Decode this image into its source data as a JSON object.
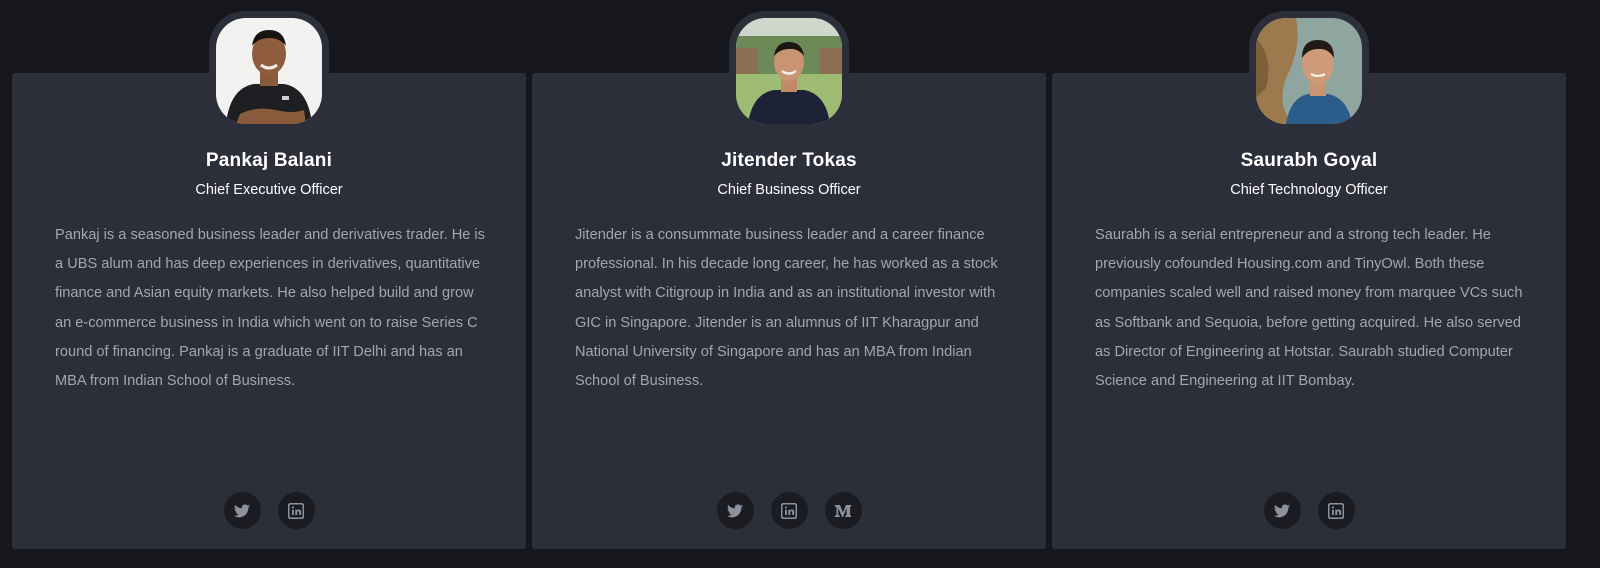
{
  "team": [
    {
      "name": "Pankaj Balani",
      "role": "Chief Executive Officer",
      "bio": "Pankaj is a seasoned business leader and derivatives trader. He is a UBS alum and has deep experiences in derivatives, quantitative finance and Asian equity markets. He also helped build and grow an e-commerce business in India which went on to raise Series C round of financing. Pankaj is a graduate of IIT Delhi and has an MBA from Indian School of Business.",
      "socials": [
        "twitter-icon",
        "linkedin-icon"
      ]
    },
    {
      "name": "Jitender Tokas",
      "role": "Chief Business Officer",
      "bio": "Jitender is a consummate business leader and a career finance professional. In his decade long career, he has worked as a stock analyst with Citigroup in India and as an institutional investor with GIC in Singapore. Jitender is an alumnus of IIT Kharagpur and National University of Singapore and has an MBA from Indian School of Business.",
      "socials": [
        "twitter-icon",
        "linkedin-icon",
        "medium-icon"
      ]
    },
    {
      "name": "Saurabh Goyal",
      "role": "Chief Technology Officer",
      "bio": "Saurabh is a serial entrepreneur and a strong tech leader. He previously cofounded Housing.com and TinyOwl. Both these companies scaled well and raised money from marquee VCs such as Softbank and Sequoia, before getting acquired. He also served as Director of Engineering at Hotstar. Saurabh studied Computer Science and Engineering at IIT Bombay.",
      "socials": [
        "twitter-icon",
        "linkedin-icon"
      ]
    }
  ],
  "colors": {
    "page_bg": "#16171c",
    "card_bg": "#2c2e3a",
    "body_text": "#a3a6b2",
    "heading_text": "#ffffff",
    "social_bg": "#1b1c22",
    "social_icon": "#8e919d"
  }
}
